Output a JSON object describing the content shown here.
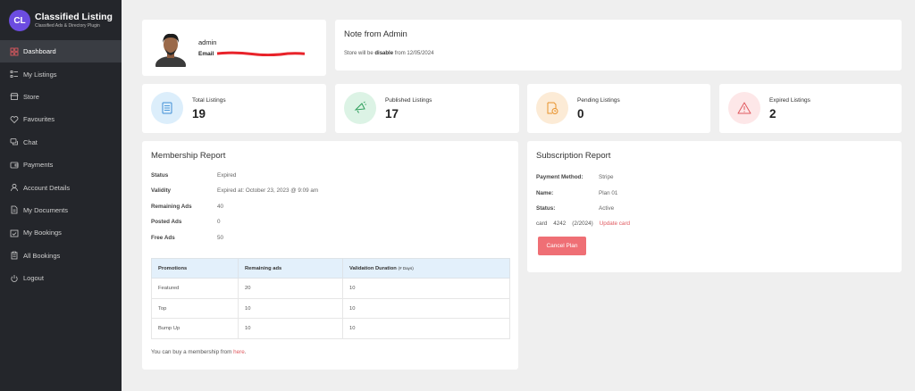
{
  "sidebar": {
    "brand": {
      "logo_text": "CL",
      "title": "Classified Listing",
      "subtitle": "Classified Ads & Directory Plugin"
    },
    "items": [
      {
        "label": "Dashboard",
        "icon": "dashboard-icon"
      },
      {
        "label": "My Listings",
        "icon": "list-icon"
      },
      {
        "label": "Store",
        "icon": "store-icon"
      },
      {
        "label": "Favourites",
        "icon": "heart-icon"
      },
      {
        "label": "Chat",
        "icon": "chat-icon"
      },
      {
        "label": "Payments",
        "icon": "wallet-icon"
      },
      {
        "label": "Account Details",
        "icon": "user-icon"
      },
      {
        "label": "My Documents",
        "icon": "document-icon"
      },
      {
        "label": "My Bookings",
        "icon": "calendar-check-icon"
      },
      {
        "label": "All Bookings",
        "icon": "clipboard-icon"
      },
      {
        "label": "Logout",
        "icon": "power-icon"
      }
    ],
    "active_index": 0
  },
  "profile": {
    "name": "admin",
    "email_label": "Email"
  },
  "note": {
    "title": "Note from Admin",
    "text_before": "Store will be ",
    "text_bold": "disable",
    "text_after": " from 12/05/2024"
  },
  "stats": [
    {
      "label": "Total Listings",
      "value": "19",
      "icon": "document-list-icon",
      "color": "#3f8fd6",
      "bg": "#dceefb"
    },
    {
      "label": "Published Listings",
      "value": "17",
      "icon": "megaphone-icon",
      "color": "#2e9e5b",
      "bg": "#dcf3e5"
    },
    {
      "label": "Pending Listings",
      "value": "0",
      "icon": "pending-clock-icon",
      "color": "#e8932c",
      "bg": "#fcebd6"
    },
    {
      "label": "Expired Listings",
      "value": "2",
      "icon": "warning-icon",
      "color": "#e0595f",
      "bg": "#fde7e8"
    }
  ],
  "membership": {
    "title": "Membership Report",
    "rows": [
      {
        "key": "Status",
        "value": "Expired"
      },
      {
        "key": "Validity",
        "value": "Expired at: October 23, 2023 @ 9:09 am"
      },
      {
        "key": "Remaining Ads",
        "value": "40"
      },
      {
        "key": "Posted Ads",
        "value": "0"
      },
      {
        "key": "Free Ads",
        "value": "50"
      }
    ],
    "table": {
      "headers": [
        "Promotions",
        "Remaining ads",
        "Validation Duration"
      ],
      "header_note": "(# Days)",
      "rows": [
        [
          "Featured",
          "20",
          "10"
        ],
        [
          "Top",
          "10",
          "10"
        ],
        [
          "Bump Up",
          "10",
          "10"
        ]
      ]
    },
    "buy_text": "You can buy a membership from ",
    "buy_link": "here",
    "buy_end": "."
  },
  "subscription": {
    "title": "Subscription Report",
    "rows": [
      {
        "key": "Payment Method:",
        "value": "Stripe"
      },
      {
        "key": "Name:",
        "value": "Plan 01"
      },
      {
        "key": "Status:",
        "value": "Active"
      }
    ],
    "card_label": "card",
    "card_last4": "4242",
    "card_exp": "(2/2024)",
    "update_card": "Update card",
    "cancel_button": "Cancel Plan"
  },
  "colors": {
    "sidebar_bg": "#24262b",
    "accent_red": "#ef6f75",
    "link": "#e0595f",
    "table_header": "#e3f0fb"
  }
}
